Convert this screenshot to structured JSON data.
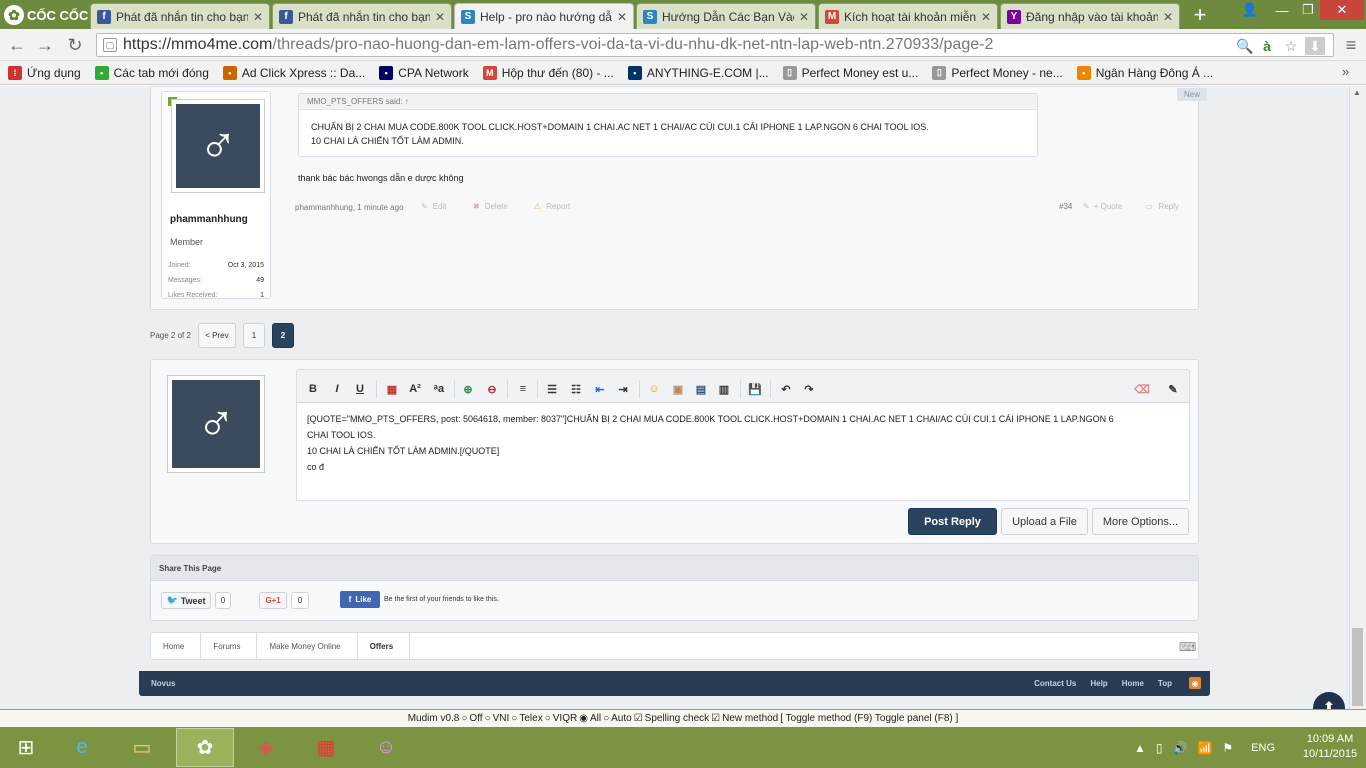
{
  "browser": {
    "brand": "CỐC CỐC",
    "tabs": [
      {
        "title": "Phát đã nhắn tin cho bạn",
        "icon": "facebook-icon",
        "color": "#3b5998",
        "active": false
      },
      {
        "title": "Phát đã nhắn tin cho bạn",
        "icon": "facebook-icon",
        "color": "#3b5998",
        "active": false
      },
      {
        "title": "Help - pro nào hướng dẫ",
        "icon": "mmo4me-icon",
        "color": "#2e86c1",
        "active": true
      },
      {
        "title": "Hướng Dẫn Các Bạn Vào",
        "icon": "mmo4me-icon",
        "color": "#2e86c1",
        "active": false
      },
      {
        "title": "Kích hoạt tài khoản miễn",
        "icon": "gmail-icon",
        "color": "#d44638",
        "active": false
      },
      {
        "title": "Đăng nhập vào tài khoản",
        "icon": "yahoo-icon",
        "color": "#7b0099",
        "active": false
      }
    ],
    "url_host": "https://mmo4me.com",
    "url_path": "/threads/pro-nao-huong-dan-em-lam-offers-voi-da-ta-vi-du-nhu-dk-net-ntn-lap-web-ntn.270933/page-2",
    "bookmarks": [
      {
        "label": "Ứng dụng",
        "icon": "apps-icon"
      },
      {
        "label": "Các tab mới đóng",
        "icon": "history-icon"
      },
      {
        "label": "Ad Click Xpress :: Da...",
        "icon": "adclick-icon"
      },
      {
        "label": "CPA Network",
        "icon": "cpa-icon"
      },
      {
        "label": "Hộp thư đến (80) - ...",
        "icon": "gmail-icon"
      },
      {
        "label": "ANYTHING-E.COM |...",
        "icon": "anything-icon"
      },
      {
        "label": "Perfect Money est u...",
        "icon": "page-icon"
      },
      {
        "label": "Perfect Money - ne...",
        "icon": "page-icon"
      },
      {
        "label": "Ngân Hàng Đông Á ...",
        "icon": "bank-icon"
      }
    ]
  },
  "post": {
    "new_badge": "New",
    "quote_author": "MMO_PTS_OFFERS said: ↑",
    "quote_line1": "CHUẨN BỊ 2 CHAI MUA CODE.800K TOOL CLICK.HOST+DOMAIN 1 CHAI.AC NET 1 CHAI/AC CÙI CUI.1 CÁI IPHONE 1 LAP.NGON 6 CHAI TOOL IOS.",
    "quote_line2": "10 CHAI LÀ CHIẾN TỐT LÀM ADMIN.",
    "message": "thank bác bác hwongs dẫn e dược không",
    "meta": "phammanhhung, 1 minute ago",
    "edit": "Edit",
    "delete": "Delete",
    "report": "Report",
    "number": "#34",
    "quote": "+ Quote",
    "reply": "Reply",
    "username": "phammanhhung",
    "role": "Member",
    "joined_label": "Joined:",
    "joined": "Oct 3, 2015",
    "messages_label": "Messages:",
    "messages": "49",
    "likes_label": "Likes Received:",
    "likes": "1"
  },
  "pagination": {
    "label": "Page 2 of 2",
    "prev": "< Prev",
    "p1": "1",
    "p2": "2"
  },
  "editor": {
    "line1": "[QUOTE=\"MMO_PTS_OFFERS, post: 5064618, member: 8037\"]CHUẨN BỊ 2 CHAI MUA CODE.800K TOOL CLICK.HOST+DOMAIN 1 CHAI.AC NET 1 CHAI/AC CÙI CUI.1 CÁI IPHONE 1 LAP.NGON 6",
    "line2": "CHAI TOOL IOS.",
    "line3": "10 CHAI LÀ CHIẾN TỐT LÀM ADMIN.[/QUOTE]",
    "line4": "co đ",
    "post_reply": "Post Reply",
    "upload": "Upload a File",
    "more": "More Options..."
  },
  "share": {
    "title": "Share This Page",
    "tweet": "Tweet",
    "tweet_count": "0",
    "gplus": "G+1",
    "gplus_count": "0",
    "like": "Like",
    "like_text": "Be the first of your friends to like this."
  },
  "breadcrumb": [
    "Home",
    "Forums",
    "Make Money Online",
    "Offers"
  ],
  "footer": {
    "style": "Novus",
    "links": [
      "Contact Us",
      "Help",
      "Home",
      "Top"
    ]
  },
  "mudim": {
    "text": "Mudim v0.8",
    "off": "Off",
    "vni": "VNI",
    "telex": "Telex",
    "viqr": "VIQR",
    "all": "All",
    "auto": "Auto",
    "spell": "Spelling check",
    "newm": "New method",
    "toggle": "[ Toggle method (F9) Toggle panel (F8) ]"
  },
  "taskbar": {
    "lang": "ENG",
    "time": "10:09 AM",
    "date": "10/11/2015"
  }
}
